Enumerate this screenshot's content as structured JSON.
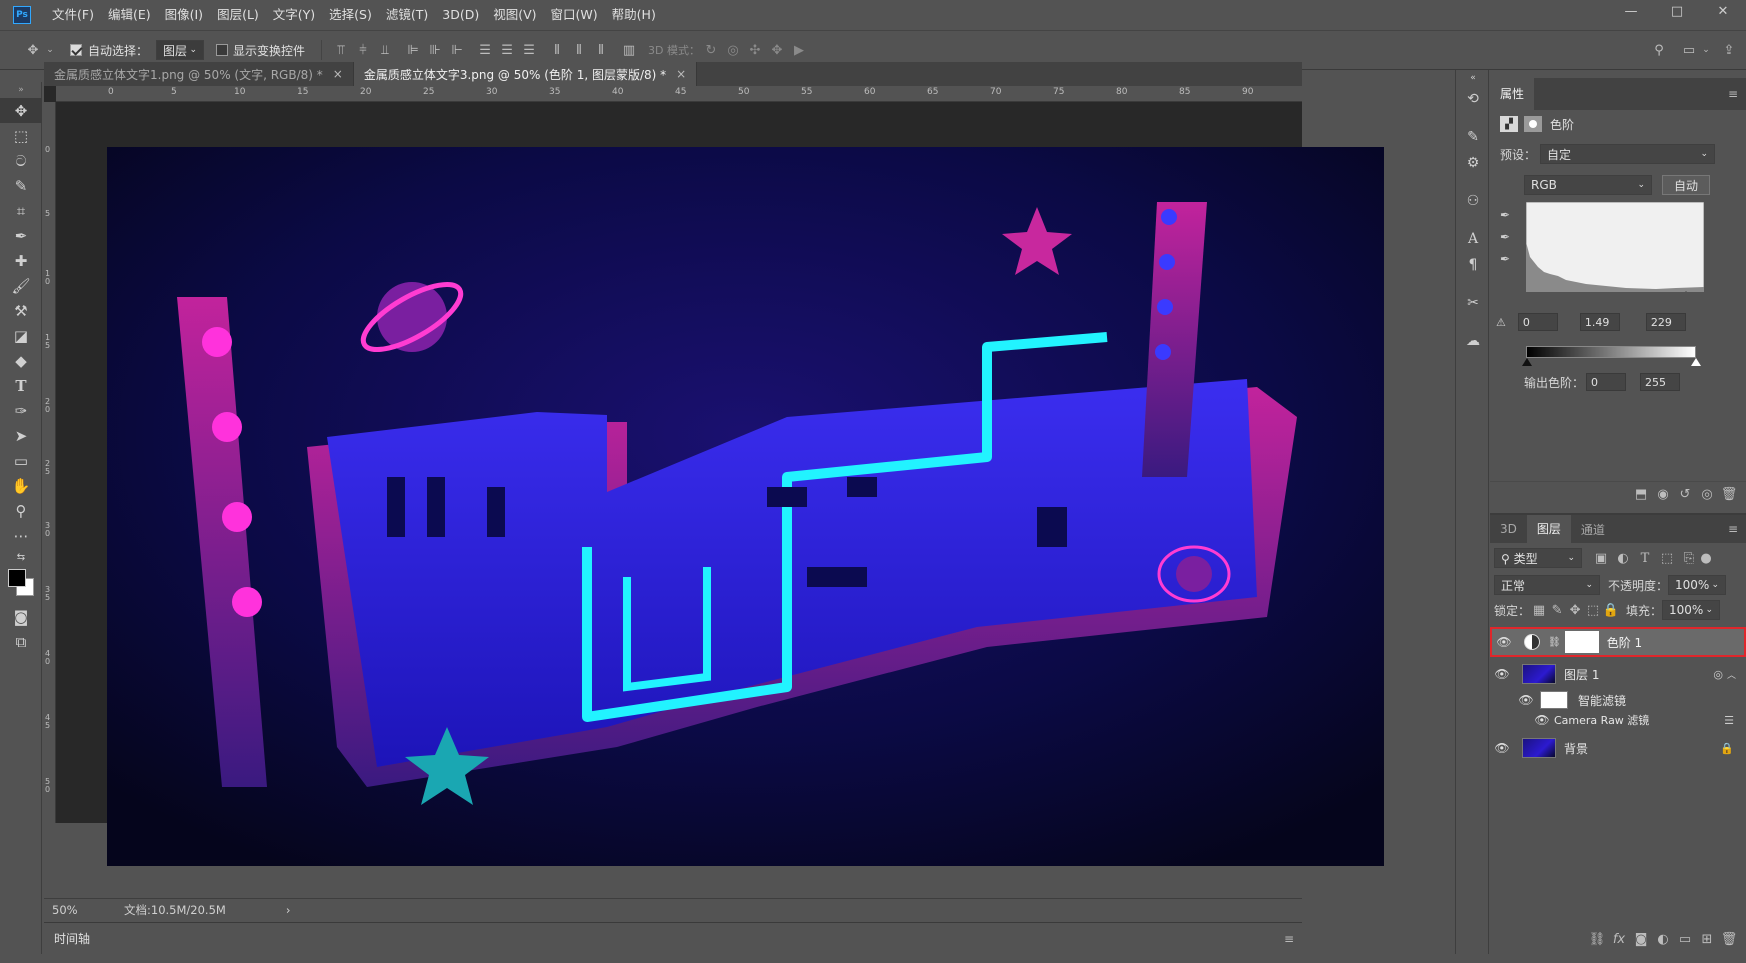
{
  "app": {
    "logo": "Ps"
  },
  "menu": [
    "文件(F)",
    "编辑(E)",
    "图像(I)",
    "图层(L)",
    "文字(Y)",
    "选择(S)",
    "滤镜(T)",
    "3D(D)",
    "视图(V)",
    "窗口(W)",
    "帮助(H)"
  ],
  "window_controls": {
    "minimize": "—",
    "restore": "□",
    "close": "✕"
  },
  "options": {
    "auto_select_label": "自动选择：",
    "auto_select_checked": true,
    "auto_select_target": "图层",
    "show_transform_label": "显示变换控件",
    "show_transform_checked": false,
    "mode_3d_label": "3D 模式："
  },
  "tabs": [
    {
      "title": "金属质感立体文字1.png @ 50% (文字, RGB/8) *",
      "close": "×",
      "active": false
    },
    {
      "title": "金属质感立体文字3.png @ 50% (色阶 1, 图层蒙版/8) *",
      "close": "×",
      "active": true
    }
  ],
  "ruler_h": [
    "0",
    "5",
    "10",
    "15",
    "20",
    "25",
    "30",
    "35",
    "40",
    "45",
    "50",
    "55",
    "60",
    "65",
    "70",
    "75",
    "80",
    "85",
    "90"
  ],
  "ruler_v": [
    "0",
    "5",
    "1 0",
    "1 5",
    "2 0",
    "2 5",
    "3 0",
    "3 5",
    "4 0",
    "4 5",
    "5 0"
  ],
  "status": {
    "zoom": "50%",
    "doc": "文档:10.5M/20.5M",
    "arrow": "›"
  },
  "timeline": {
    "label": "时间轴"
  },
  "properties": {
    "title": "属性",
    "adj_name": "色阶",
    "preset_label": "预设：",
    "preset_value": "自定",
    "channel": "RGB",
    "auto_button": "自动",
    "input_black": "0",
    "input_gamma": "1.49",
    "input_white": "229",
    "output_label": "输出色阶：",
    "output_black": "0",
    "output_white": "255"
  },
  "layers_panel": {
    "tabs": [
      "3D",
      "图层",
      "通道"
    ],
    "active_tab": "图层",
    "filter_kind": "类型",
    "blend_mode": "正常",
    "opacity_label": "不透明度：",
    "opacity": "100%",
    "lock_label": "锁定：",
    "fill_label": "填充：",
    "fill": "100%",
    "layers": [
      {
        "name": "色阶 1",
        "selected": true
      },
      {
        "name": "图层 1",
        "selected": false
      },
      {
        "name": "智能滤镜",
        "selected": false
      },
      {
        "name": "Camera Raw 滤镜",
        "selected": false
      },
      {
        "name": "背景",
        "selected": false
      }
    ]
  },
  "colors": {
    "accent": "#31a8ff",
    "highlight": "#e0262b",
    "panel": "#535353",
    "dark": "#282828"
  }
}
